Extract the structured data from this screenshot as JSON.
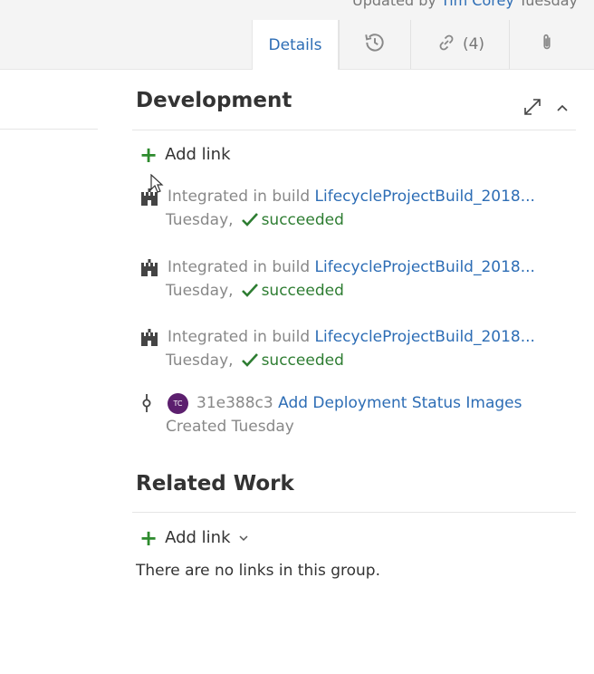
{
  "header": {
    "updated_prefix": "Updated by",
    "updated_by": "Tim Corey",
    "updated_when": "Tuesday"
  },
  "tabs": [
    {
      "label": "Details",
      "active": true
    },
    {
      "icon": "history-icon"
    },
    {
      "icon": "link-icon",
      "count": "(4)"
    },
    {
      "icon": "attachment-icon"
    }
  ],
  "development": {
    "title": "Development",
    "add_link_label": "Add link",
    "builds": [
      {
        "prefix": "Integrated in build",
        "name": "LifecycleProjectBuild_2018...",
        "date": "Tuesday,",
        "status": "succeeded"
      },
      {
        "prefix": "Integrated in build",
        "name": "LifecycleProjectBuild_2018...",
        "date": "Tuesday,",
        "status": "succeeded"
      },
      {
        "prefix": "Integrated in build",
        "name": "LifecycleProjectBuild_2018...",
        "date": "Tuesday,",
        "status": "succeeded"
      }
    ],
    "commit": {
      "avatar_initials": "TC",
      "hash": "31e388c3",
      "message": "Add Deployment Status Images",
      "created": "Created Tuesday"
    }
  },
  "related_work": {
    "title": "Related Work",
    "add_link_label": "Add link",
    "empty_text": "There are no links in this group."
  },
  "colors": {
    "accent": "#2d6db5",
    "success": "#2e7d32",
    "avatar": "#5c1f6e"
  }
}
